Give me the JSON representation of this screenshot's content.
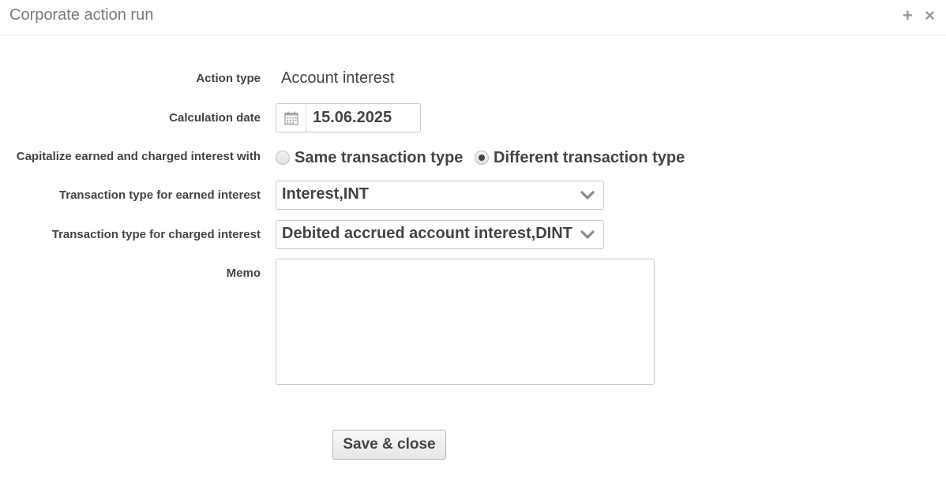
{
  "window": {
    "title": "Corporate action run",
    "controls": {
      "add_icon": "plus-icon",
      "close_icon": "close-icon"
    }
  },
  "form": {
    "action_type": {
      "label": "Action type",
      "value": "Account interest"
    },
    "calculation_date": {
      "label": "Calculation date",
      "value": "15.06.2025",
      "icon": "calendar-icon"
    },
    "capitalize": {
      "label": "Capitalize earned and charged interest with",
      "options": [
        {
          "label": "Same transaction type",
          "checked": false
        },
        {
          "label": "Different transaction type",
          "checked": true
        }
      ]
    },
    "earned_interest": {
      "label": "Transaction type for earned interest",
      "value": "Interest,INT"
    },
    "charged_interest": {
      "label": "Transaction type for charged interest",
      "value": "Debited accrued account interest,DINT"
    },
    "memo": {
      "label": "Memo",
      "value": ""
    }
  },
  "actions": {
    "save_close_label": "Save & close"
  },
  "colors": {
    "text": "#444444",
    "border": "#c8c8c8",
    "title": "#7a7a7a"
  }
}
